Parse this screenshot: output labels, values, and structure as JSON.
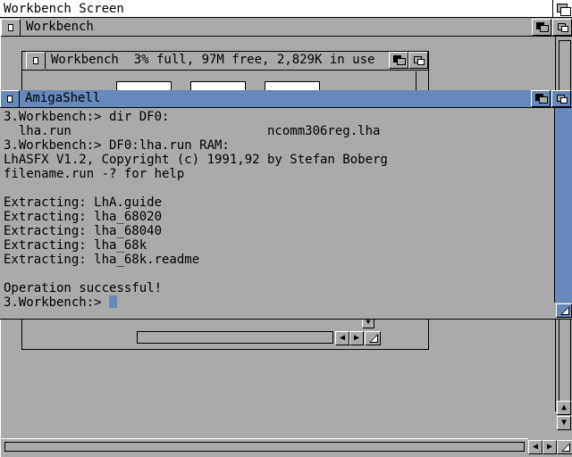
{
  "screen": {
    "title": "Workbench Screen"
  },
  "workbench_window": {
    "title": "Workbench"
  },
  "drive_window": {
    "title": "Workbench  3% full, 97M free, 2,829K in use"
  },
  "shell_window": {
    "title": "AmigaShell",
    "lines": [
      "3.Workbench:> dir DF0:",
      "  lha.run                          ncomm306reg.lha",
      "3.Workbench:> DF0:lha.run RAM:",
      "LhASFX V1.2, Copyright (c) 1991,92 by Stefan Boberg",
      "filename.run -? for help",
      "",
      "Extracting: LhA.guide",
      "Extracting: lha_68020",
      "Extracting: lha_68040",
      "Extracting: lha_68k",
      "Extracting: lha_68k.readme",
      "",
      "Operation successful!"
    ],
    "prompt": "3.Workbench:> "
  },
  "colors": {
    "background": "#aaaaaa",
    "active_title": "#6688bb",
    "text": "#000000",
    "highlight": "#ffffff"
  }
}
